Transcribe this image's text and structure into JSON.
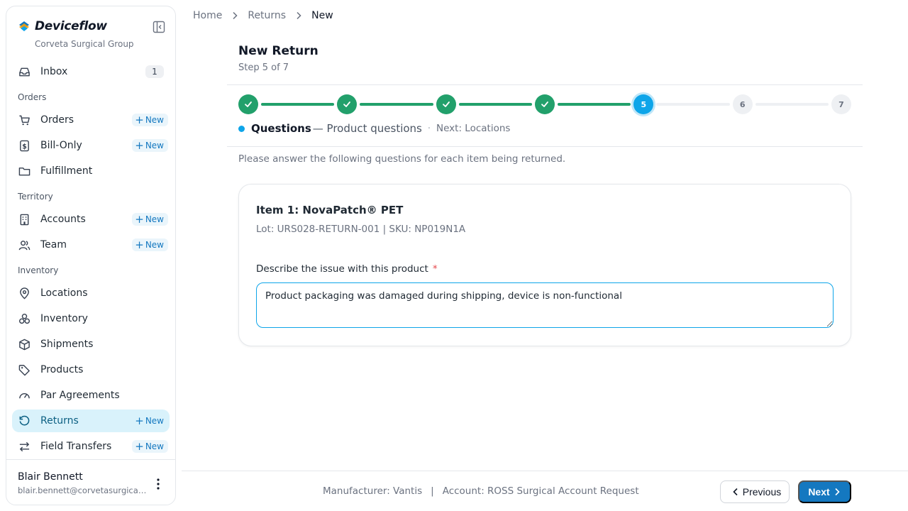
{
  "app": {
    "brand_name": "Deviceflow",
    "org_name": "Corveta Surgical Group"
  },
  "colors": {
    "accent": "#0ea5e9",
    "done": "#22a06b",
    "primary_button": "#1478c0",
    "active_nav_bg": "#d9f2fb"
  },
  "sidebar": {
    "inbox": {
      "label": "Inbox",
      "count": "1",
      "icon": "inbox-icon"
    },
    "sections": {
      "orders": "Orders",
      "territory": "Territory",
      "inventory": "Inventory"
    },
    "items": {
      "orders": {
        "label": "Orders",
        "new": "New",
        "icon": "cart-icon"
      },
      "bill_only": {
        "label": "Bill-Only",
        "new": "New",
        "icon": "dollar-receipt-icon"
      },
      "fulfillment": {
        "label": "Fulfillment",
        "icon": "folder-icon"
      },
      "accounts": {
        "label": "Accounts",
        "new": "New",
        "icon": "building-icon"
      },
      "team": {
        "label": "Team",
        "new": "New",
        "icon": "users-icon"
      },
      "locations": {
        "label": "Locations",
        "icon": "map-pin-icon"
      },
      "inventory": {
        "label": "Inventory",
        "icon": "boxes-icon"
      },
      "shipments": {
        "label": "Shipments",
        "icon": "package-icon"
      },
      "products": {
        "label": "Products",
        "icon": "tag-icon"
      },
      "par_agreements": {
        "label": "Par Agreements",
        "icon": "gauge-icon"
      },
      "returns": {
        "label": "Returns",
        "new": "New",
        "icon": "rotate-ccw-icon",
        "active": true
      },
      "field_transfers": {
        "label": "Field Transfers",
        "new": "New",
        "icon": "arrows-exchange-icon"
      }
    },
    "user": {
      "name": "Blair Bennett",
      "email": "blair.bennett@corvetasurgical.com"
    }
  },
  "breadcrumb": [
    "Home",
    "Returns",
    "New"
  ],
  "page": {
    "title": "New Return",
    "step_count": "Step 5 of 7"
  },
  "stepper": {
    "total_steps": 7,
    "current_step": 5,
    "steps": [
      "1",
      "2",
      "3",
      "4",
      "5",
      "6",
      "7"
    ],
    "current_name": "Questions",
    "current_desc": "— Product questions",
    "separator": "·",
    "next_label": "Next: Locations"
  },
  "instructions": "Please answer the following questions for each item being returned.",
  "item": {
    "title": "Item 1: NovaPatch® PET",
    "meta": "Lot: URS028-RETURN-001 | SKU: NP019N1A",
    "question_label": "Describe the issue with this product",
    "required_mark": "*",
    "answer": "Product packaging was damaged during shipping, device is non-functional"
  },
  "footer": {
    "manufacturer": "Manufacturer: Vantis",
    "divider": "|",
    "account": "Account: ROSS Surgical Account Request",
    "previous_label": "Previous",
    "next_label": "Next"
  }
}
